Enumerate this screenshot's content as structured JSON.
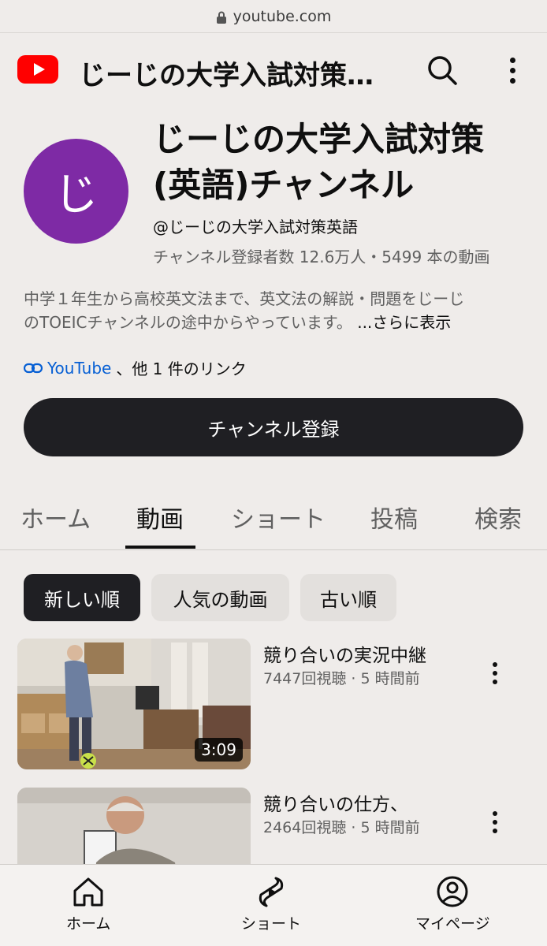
{
  "browser": {
    "url": "youtube.com"
  },
  "header": {
    "title": "じーじの大学入試対策…"
  },
  "channel": {
    "avatar_letter": "じ",
    "name_line1": "じーじの大学入試対策",
    "name_line2": "(英語)チャンネル",
    "handle": "@じーじの大学入試対策英語",
    "stats": "チャンネル登録者数 12.6万人・5499 本の動画",
    "description_line1": "中学１年生から高校英文法まで、英文法の解説・問題をじーじ",
    "description_line2": "のTOEICチャンネルの途中からやっています。",
    "description_more": "...さらに表示",
    "link_label": "YouTube",
    "link_suffix": "、他 1 件のリンク",
    "subscribe_label": "チャンネル登録",
    "avatar_color": "#7e2aa5"
  },
  "tabs": [
    {
      "label": "ホーム",
      "active": false
    },
    {
      "label": "動画",
      "active": true
    },
    {
      "label": "ショート",
      "active": false
    },
    {
      "label": "投稿",
      "active": false
    },
    {
      "label": "検索",
      "active": false
    }
  ],
  "chips": [
    {
      "label": "新しい順",
      "active": true
    },
    {
      "label": "人気の動画",
      "active": false
    },
    {
      "label": "古い順",
      "active": false
    }
  ],
  "videos": [
    {
      "title": "競り合いの実況中継",
      "meta": "7447回視聴 · 5 時間前",
      "duration": "3:09"
    },
    {
      "title": "競り合いの仕方、",
      "meta": "2464回視聴 · 5 時間前",
      "duration": ""
    }
  ],
  "bottom_nav": [
    {
      "label": "ホーム",
      "icon": "home-icon"
    },
    {
      "label": "ショート",
      "icon": "shorts-icon"
    },
    {
      "label": "マイページ",
      "icon": "account-icon"
    }
  ],
  "colors": {
    "brand_red": "#ff0000",
    "dark_button": "#1f1f23",
    "link_blue": "#065fd4"
  }
}
